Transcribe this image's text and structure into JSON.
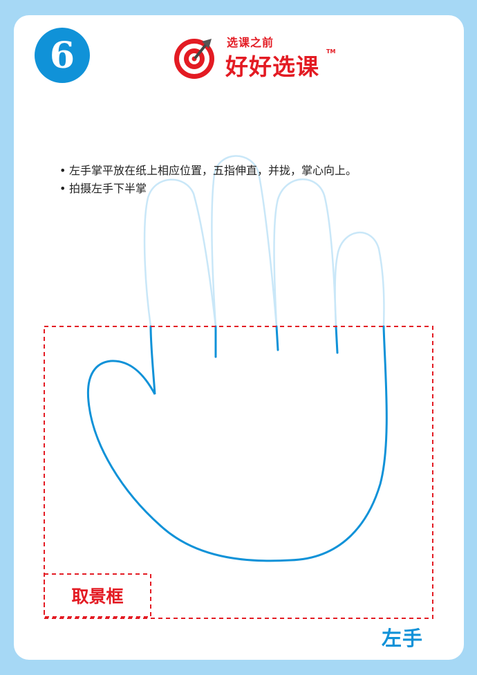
{
  "step": {
    "number": "6"
  },
  "logo": {
    "tagline": "选课之前",
    "name": "好好选课",
    "trademark": "TM",
    "icon": "target-arrow-icon",
    "color": "#e31b23"
  },
  "instructions": [
    "左手掌平放在纸上相应位置，五指伸直，并拢，掌心向上。",
    "拍摄左手下半掌"
  ],
  "frame": {
    "label": "取景框",
    "color": "#e31b23"
  },
  "hand": {
    "side_label": "左手",
    "outline_color": "#1092d8",
    "faded_color": "#c9e7f8"
  },
  "colors": {
    "background": "#a6d8f5",
    "card": "#ffffff",
    "accent": "#1092d8"
  }
}
